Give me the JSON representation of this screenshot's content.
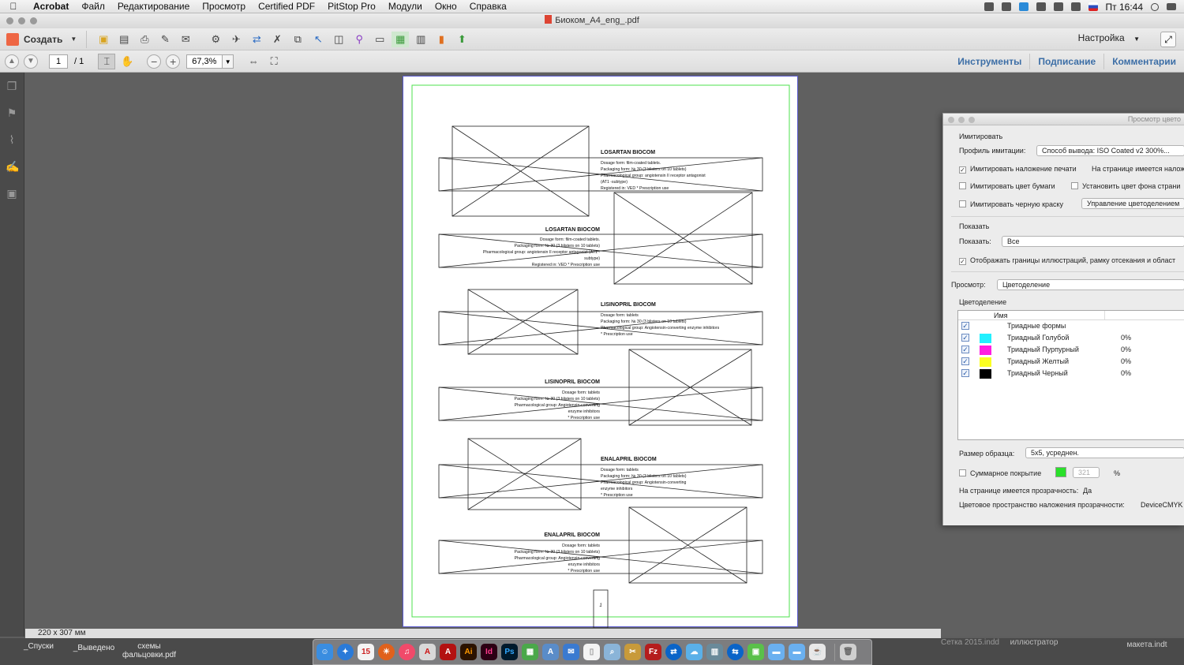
{
  "menubar": {
    "app": "Acrobat",
    "items": [
      "Файл",
      "Редактирование",
      "Просмотр",
      "Certified PDF",
      "PitStop Pro",
      "Модули",
      "Окно",
      "Справка"
    ],
    "clock": "Пт 16:44"
  },
  "window": {
    "title": "Биоком_A4_eng_.pdf"
  },
  "toolbar": {
    "create_label": "Создать",
    "settings_label": "Настройка"
  },
  "nav": {
    "page_current": "1",
    "page_total": "/ 1",
    "zoom": "67,3%",
    "tabs": [
      "Инструменты",
      "Подписание",
      "Комментарии"
    ]
  },
  "status": {
    "page_size": "220 x 307 мм"
  },
  "desktop": {
    "left_labels": [
      "_Спуски",
      "_Выведено",
      "схемы фальцовки.pdf"
    ],
    "right_labels": [
      "Сетка 2015.indd",
      "иллюстратор",
      "макета.indt"
    ]
  },
  "document": {
    "page_number": "1",
    "blocks": [
      {
        "title": "LOSARTAN BIOCOM",
        "lines": [
          "Dosage form: film-coated tablets.",
          "Packaging form: № 30 (3 blisters on 10 tablets)",
          "Pharmacological group: angiotensin II receptor antagonist",
          "(AT1 -subtype)",
          "Registered in: VED * Prescription use"
        ]
      },
      {
        "title": "LOSARTAN BIOCOM",
        "lines": [
          "Dosage form: film-coated tablets.",
          "Packaging form: № 30 (3 blisters on 10 tablets)",
          "Pharmacological group: angiotensin II receptor antagonist (AT1 -",
          "subtype)",
          "Registered in: VED * Prescription use"
        ]
      },
      {
        "title": "LISINOPRIL BIOCOM",
        "lines": [
          "Dosage form: tablets",
          "Packaging form: № 30 (3 blisters on 10 tablets)",
          "Pharmacological group: Angiotensin-converting enzyme inhibitors",
          "* Prescription use"
        ]
      },
      {
        "title": "LISINOPRIL BIOCOM",
        "lines": [
          "Dosage form: tablets",
          "Packaging form: № 30 (3 blisters on 10 tablets)",
          "Pharmacological group: Angiotensin-converting",
          "enzyme inhibitors",
          "* Prescription use"
        ]
      },
      {
        "title": "ENALAPRIL BIOCOM",
        "lines": [
          "Dosage form: tablets",
          "Packaging form: № 30 (3 blisters on 10 tablets)",
          "Pharmacological group: Angiotensin-converting",
          "enzyme inhibitors",
          "* Prescription use"
        ]
      },
      {
        "title": "ENALAPRIL BIOCOM",
        "lines": [
          "Dosage form: tablets",
          "Packaging form: № 30 (3 blisters on 10 tablets)",
          "Pharmacological group: Angiotensin-converting",
          "enzyme inhibitors",
          "* Prescription use"
        ]
      }
    ]
  },
  "panel": {
    "title": "Просмотр цвето",
    "section_simulate": "Имитировать",
    "profile_label": "Профиль имитации:",
    "profile_value": "Способ вывода: ISO Coated v2 300%...",
    "opt_overprint": "Имитировать наложение печати",
    "opt_overprint_right": "На странице имеется налож",
    "opt_paper": "Имитировать цвет бумаги",
    "opt_bg": "Установить цвет фона страни",
    "opt_black": "Имитировать черную краску",
    "btn_color_mgmt": "Управление цветоделением",
    "section_show": "Показать",
    "show_label": "Показать:",
    "show_value": "Все",
    "opt_borders": "Отображать границы иллюстраций, рамку отсекания и област",
    "preview_label": "Просмотр:",
    "preview_value": "Цветоделение",
    "section_separations": "Цветоделение",
    "col_name": "Имя",
    "separations": [
      {
        "name": "Триадные формы",
        "value": "",
        "color": ""
      },
      {
        "name": "Триадный Голубой",
        "value": "0%",
        "color": "#22f0ff"
      },
      {
        "name": "Триадный Пурпурный",
        "value": "0%",
        "color": "#ff1ee0"
      },
      {
        "name": "Триадный Желтый",
        "value": "0%",
        "color": "#fbff22"
      },
      {
        "name": "Триадный Черный",
        "value": "0%",
        "color": "#000000"
      }
    ],
    "sample_label": "Размер образца:",
    "sample_value": "5x5, усреднен.",
    "coverage_label": "Суммарное покрытие",
    "coverage_value": "321",
    "coverage_unit": "%",
    "transp_label": "На странице имеется прозрачность:",
    "transp_value": "Да",
    "blend_label": "Цветовое пространство наложения прозрачности:",
    "blend_value": "DeviceCMYK"
  }
}
